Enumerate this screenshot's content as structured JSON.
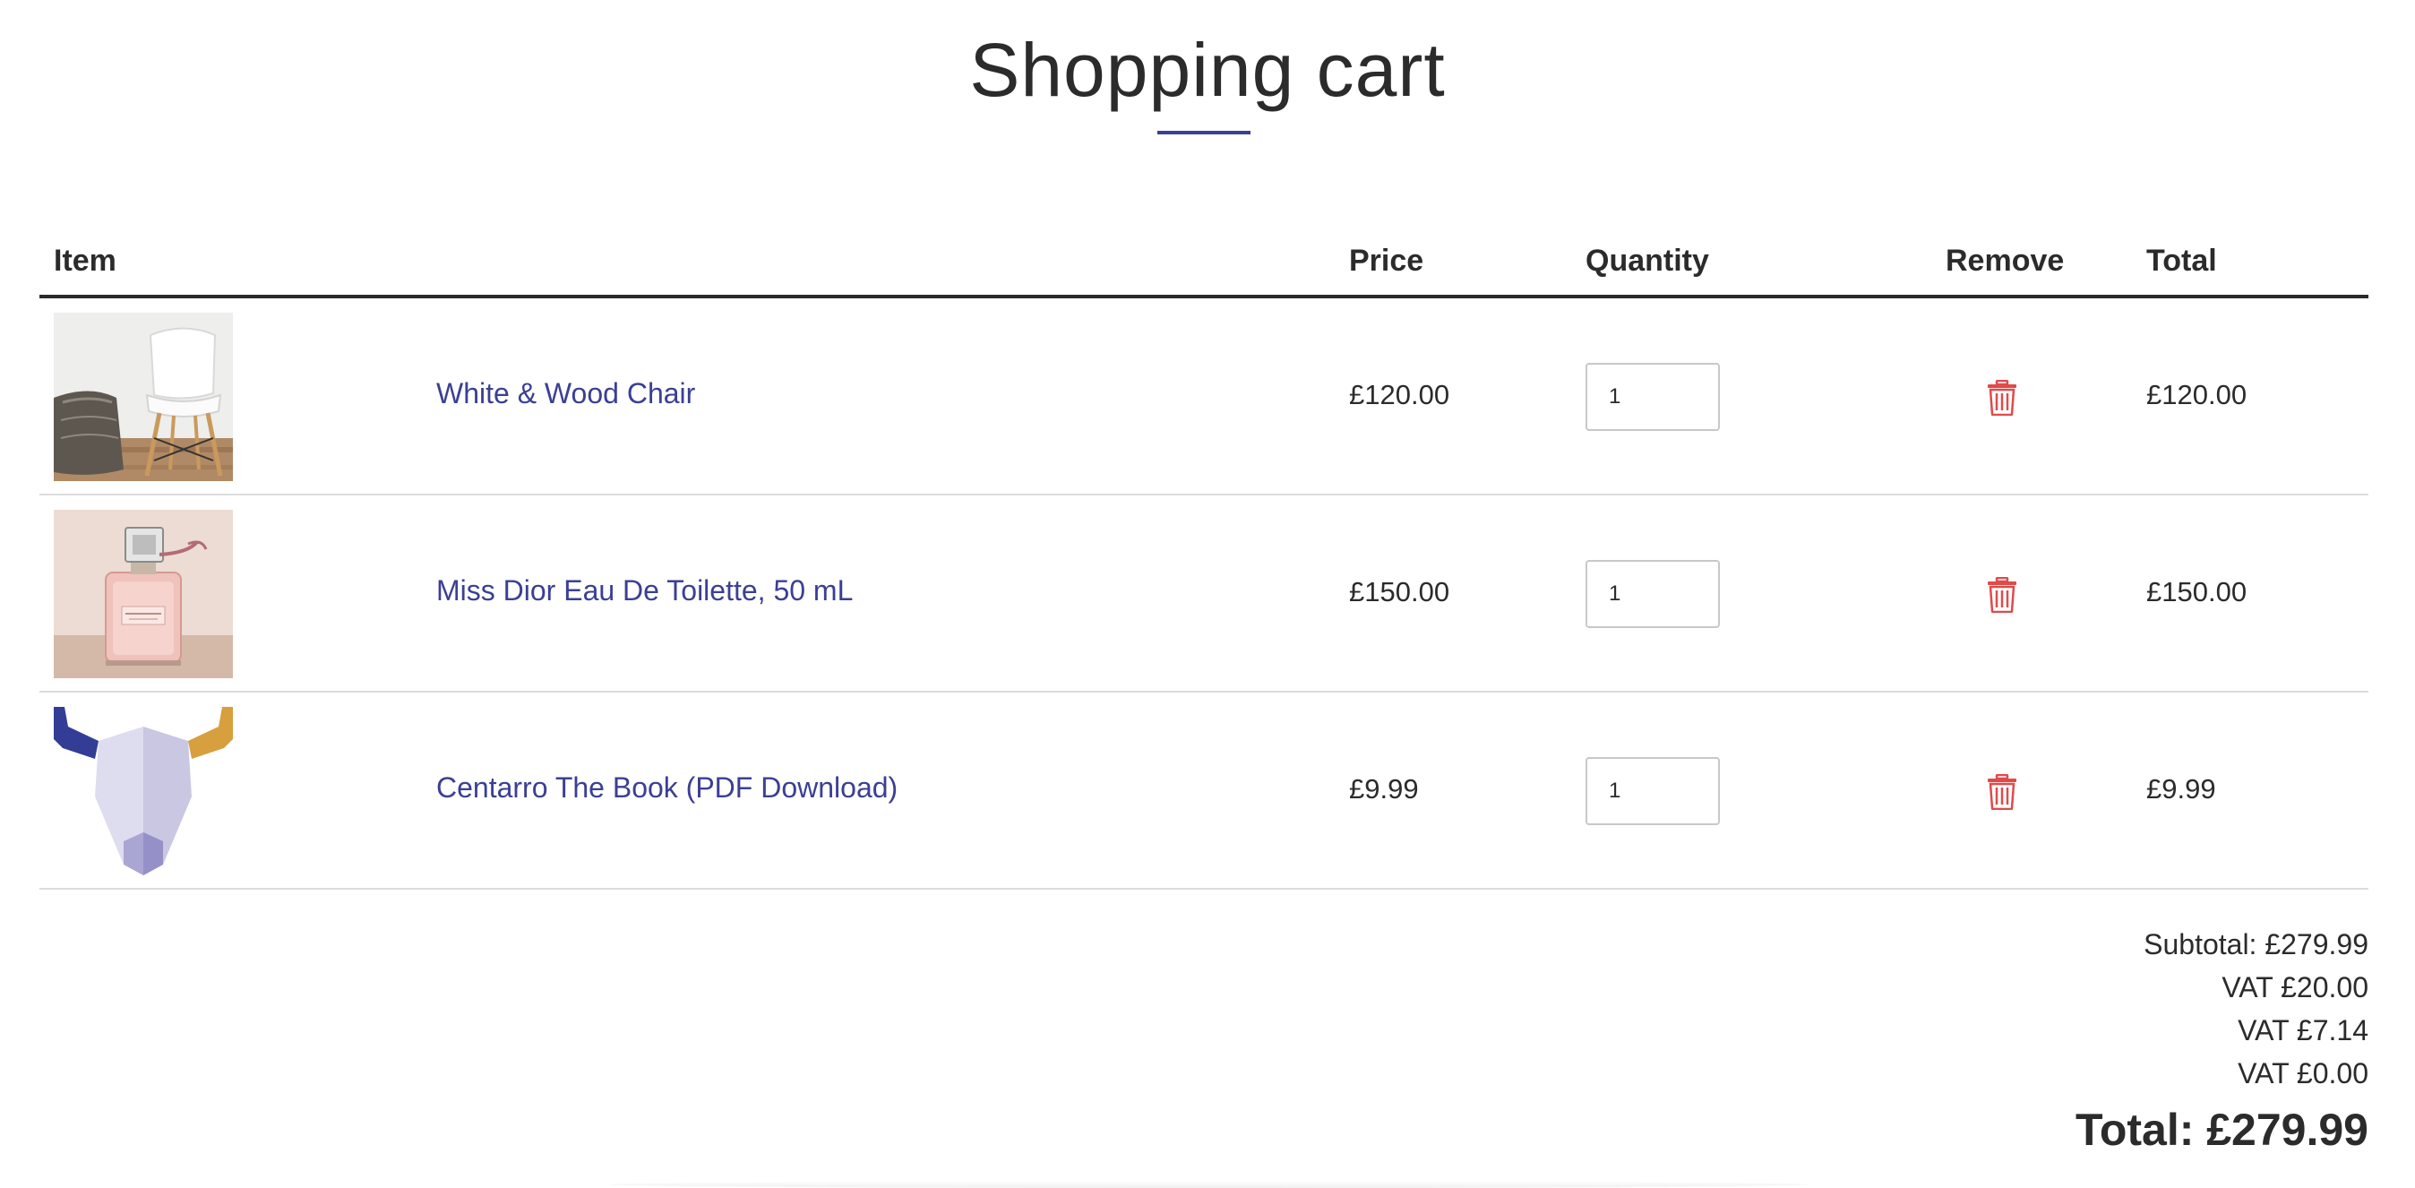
{
  "page": {
    "title": "Shopping cart",
    "accent_color": "#3b3f94",
    "remove_color": "#e04a4a"
  },
  "table": {
    "headers": {
      "item": "Item",
      "price": "Price",
      "quantity": "Quantity",
      "remove": "Remove",
      "total": "Total"
    },
    "rows": [
      {
        "image": "chair-photo",
        "name": "White & Wood Chair",
        "price": "£120.00",
        "quantity": "1",
        "remove_icon": "trash-icon",
        "total": "£120.00"
      },
      {
        "image": "perfume-photo",
        "name": "Miss Dior Eau De Toilette, 50 mL",
        "price": "£150.00",
        "quantity": "1",
        "remove_icon": "trash-icon",
        "total": "£150.00"
      },
      {
        "image": "bull-logo",
        "name": "Centarro The Book (PDF Download)",
        "price": "£9.99",
        "quantity": "1",
        "remove_icon": "trash-icon",
        "total": "£9.99"
      }
    ]
  },
  "summary": {
    "subtotal": "Subtotal: £279.99",
    "vat_lines": [
      "VAT £20.00",
      "VAT £7.14",
      "VAT £0.00"
    ],
    "total": "Total: £279.99"
  }
}
